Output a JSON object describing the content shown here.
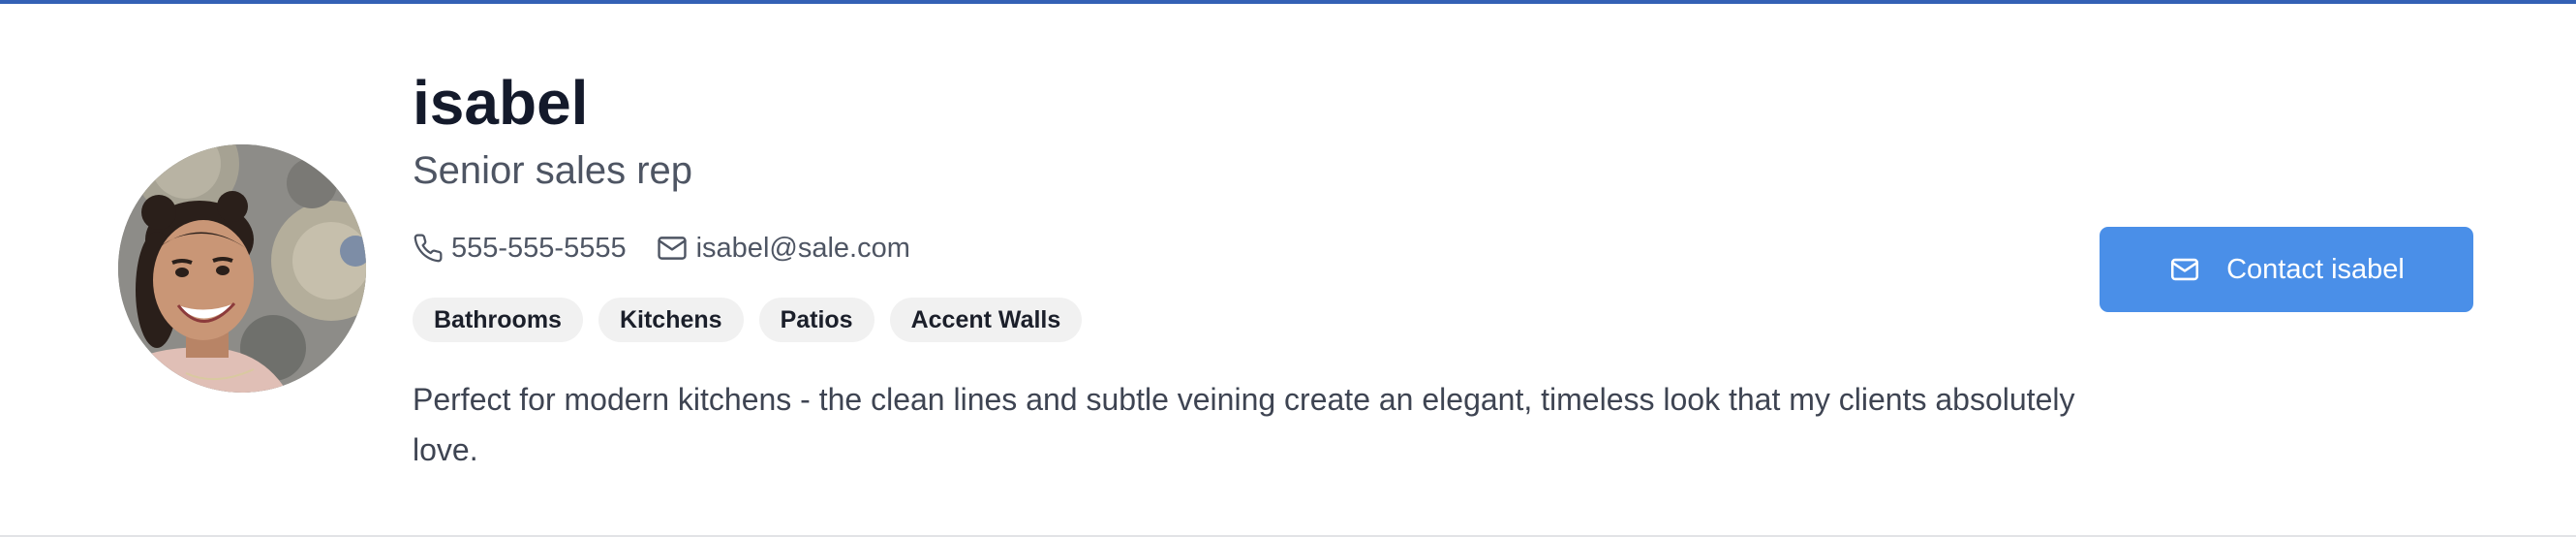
{
  "profile": {
    "name": "isabel",
    "role": "Senior sales rep",
    "phone": "555-555-5555",
    "email": "isabel@sale.com",
    "tags": [
      "Bathrooms",
      "Kitchens",
      "Patios",
      "Accent Walls"
    ],
    "quote": "Perfect for modern kitchens - the clean lines and subtle veining create an elegant, timeless look that my clients absolutely love."
  },
  "actions": {
    "contact_label": "Contact isabel"
  },
  "icons": {
    "phone": "phone-icon",
    "email": "mail-icon",
    "button": "mail-icon"
  },
  "colors": {
    "top_accent": "#3461b5",
    "button_bg": "#4a8fe8",
    "name_text": "#141a2b",
    "muted_text": "#4e5563",
    "tag_bg": "#f1f1f1"
  }
}
